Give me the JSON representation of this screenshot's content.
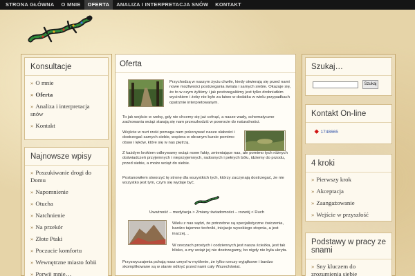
{
  "nav": {
    "items": [
      {
        "label": "STRONA GŁÓWNA",
        "active": false
      },
      {
        "label": "O MNIE",
        "active": false
      },
      {
        "label": "OFERTA",
        "active": true
      },
      {
        "label": "ANALIZA I INTERPRETACJA SNÓW",
        "active": false
      },
      {
        "label": "KONTAKT",
        "active": false
      }
    ]
  },
  "logo_icon": "lizard-logo",
  "sidebar_left": {
    "consult": {
      "title": "Konsultacje",
      "items": [
        "O mnie",
        "Oferta",
        "Analiza i interpretacja snów",
        "Kontakt"
      ],
      "current": "Oferta"
    },
    "recent": {
      "title": "Najnowsze wpisy",
      "items": [
        "Poszukiwanie drogi do Domu",
        "Napomnienie",
        "Otucha",
        "Natchnienie",
        "Na przekór",
        "Złote Ptaki",
        "Poczucie komfortu",
        "Wewnętrzne miasto fobii",
        "Porwij mnie…"
      ]
    }
  },
  "main": {
    "title": "Oferta",
    "p1": "Przychodzą w naszym życiu chwile, kiedy otwierają się przed nami nowe możliwości postrzegania świata i samych siebie. Okazuje się, że to w czym żyliśmy i jak postrzegaliśmy jest tylko drobniutkim wycinkiem i żeby nie było za łatwo w dodatku w wielu przypadkach opatrznie interpretowanym.",
    "p2": "To jak wejście w rzekę, gdy nie chcemy się już cofnąć, a nasze wady, schematyczne zachowania wciąż starają się nam przeszkodzić w powrocie do naturalności.",
    "p3": "Wejście w nurt rzeki pomaga nam pokonywać nasze słabości i dostrzegać samych siebie, wspiera w obranym kursie pomimo obaw i lęków, które się w nas piętrzą.",
    "p4": "Z każdym krokiem odkrywamy wciąż nowe fakty, zmieniające nas, ale pomimo tych różnych doświadczeń przyjemnych i nieprzyjemnych, radosnych i pełnych bólu, idziemy do przodu, przed siebie, a może wciąż do siebie.",
    "p5": "Postanowiłem stworzyć tę stronę dla wszystkich tych, którzy zaczynają dostrzegać, że nie wszystko jest tym, czym się wydaje być.",
    "caption": "Uważność – medytacja > Zmiany świadomości – rozwój < Ruch",
    "p6": "Wielu z nas sądzi, że potrzebne są specjalistyczne ćwiczenia, bardzo tajemne techniki, inicjacje wysokiego stopnia, a jest inaczej…",
    "p7": "W rzeczach prostych i codziennych jest nasza ścieżka, jest tak blisko, a my wciąż jej nie dostrzegamy, bo nigdy nie była ukryta.",
    "p8": "Przyzwyczajenia pchają nasz umysł w myślenie, że tylko rzeczy wyjątkowe i bardzo skomplikowane są w stanie odkryć przed nami cały Wszechświat."
  },
  "sidebar_right": {
    "search": {
      "title": "Szukaj…",
      "button": "Szukaj",
      "value": ""
    },
    "online": {
      "title": "Kontakt On-line",
      "number": "1748665",
      "icon": "status-star-icon"
    },
    "steps": {
      "title": "4 kroki",
      "items": [
        "Pierwszy krok",
        "Akceptacja",
        "Zaangażowanie",
        "Wejście w przyszłość"
      ]
    },
    "basics": {
      "title": "Podstawy w pracy ze snami",
      "items": [
        "Sny kluczem do zrozumienia siebie"
      ]
    }
  }
}
